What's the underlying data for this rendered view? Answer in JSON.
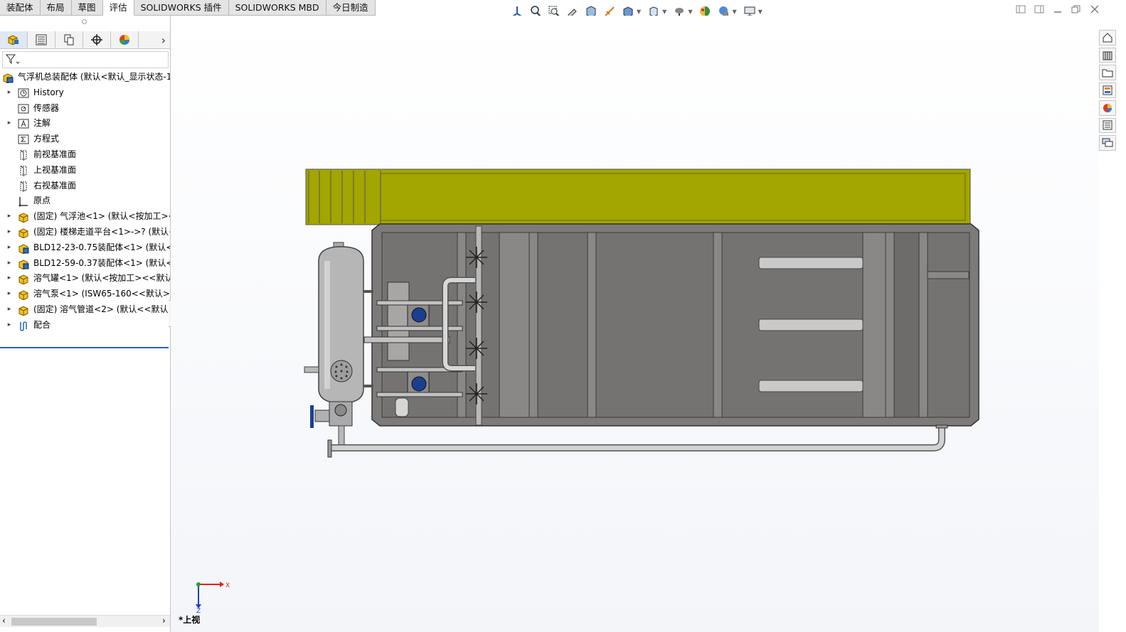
{
  "command_tabs": [
    "装配体",
    "布局",
    "草图",
    "评估",
    "SOLIDWORKS 插件",
    "SOLIDWORKS MBD",
    "今日制造"
  ],
  "active_tab": "评估",
  "heads_up_toolbar": [
    "view-orientation-icon",
    "zoom-to-fit-icon",
    "zoom-area-icon",
    "previous-view-icon",
    "section-view-icon",
    "dynamic-annotation-icon",
    "display-style-icon",
    "hide-show-icon",
    "edit-appearance-icon",
    "apply-scene-icon",
    "view-settings-icon",
    "display-monitor-icon"
  ],
  "panel_tabs": [
    "featuremanager-icon",
    "propertymanager-icon",
    "configurationmanager-icon",
    "dimxpert-icon",
    "display-manager-icon"
  ],
  "tree": {
    "root": "气浮机总装配体  (默认<默认_显示状态-1",
    "items": [
      {
        "label": "History",
        "icon": "history-icon",
        "expandable": true
      },
      {
        "label": "传感器",
        "icon": "sensor-icon",
        "expandable": false
      },
      {
        "label": "注解",
        "icon": "annotation-icon",
        "expandable": true
      },
      {
        "label": "方程式",
        "icon": "equation-icon",
        "expandable": false
      },
      {
        "label": "前视基准面",
        "icon": "plane-icon",
        "expandable": false
      },
      {
        "label": "上视基准面",
        "icon": "plane-icon",
        "expandable": false
      },
      {
        "label": "右视基准面",
        "icon": "plane-icon",
        "expandable": false
      },
      {
        "label": "原点",
        "icon": "origin-icon",
        "expandable": false
      },
      {
        "label": "(固定) 气浮池<1> (默认<按加工><",
        "icon": "part-icon",
        "expandable": true
      },
      {
        "label": "(固定) 楼梯走道平台<1>->? (默认<",
        "icon": "part-icon",
        "expandable": true
      },
      {
        "label": "BLD12-23-0.75装配体<1> (默认<默",
        "icon": "assembly-icon",
        "expandable": true
      },
      {
        "label": "BLD12-59-0.37装配体<1> (默认<默",
        "icon": "assembly-icon",
        "expandable": true
      },
      {
        "label": "溶气罐<1> (默认<按加工><<默认",
        "icon": "part-icon",
        "expandable": true
      },
      {
        "label": "溶气泵<1> (ISW65-160<<默认>_显",
        "icon": "part-icon",
        "expandable": true
      },
      {
        "label": "(固定) 溶气管道<2> (默认<<默认>",
        "icon": "part-icon",
        "expandable": true
      },
      {
        "label": "配合",
        "icon": "mates-icon",
        "expandable": true
      }
    ]
  },
  "viewport": {
    "view_name": "*上视",
    "triad_x": "X",
    "triad_z": "Z"
  },
  "colors": {
    "platform": "#a3a500",
    "tank": "#7d7b79",
    "tank_edge": "#3a3a3a",
    "steel": "#b9b9b9",
    "blue_part": "#1b3f8f"
  },
  "task_pane": [
    "solidworks-resources-icon",
    "design-library-icon",
    "file-explorer-icon",
    "view-palette-icon",
    "appearances-icon",
    "custom-properties-icon",
    "forum-icon"
  ]
}
